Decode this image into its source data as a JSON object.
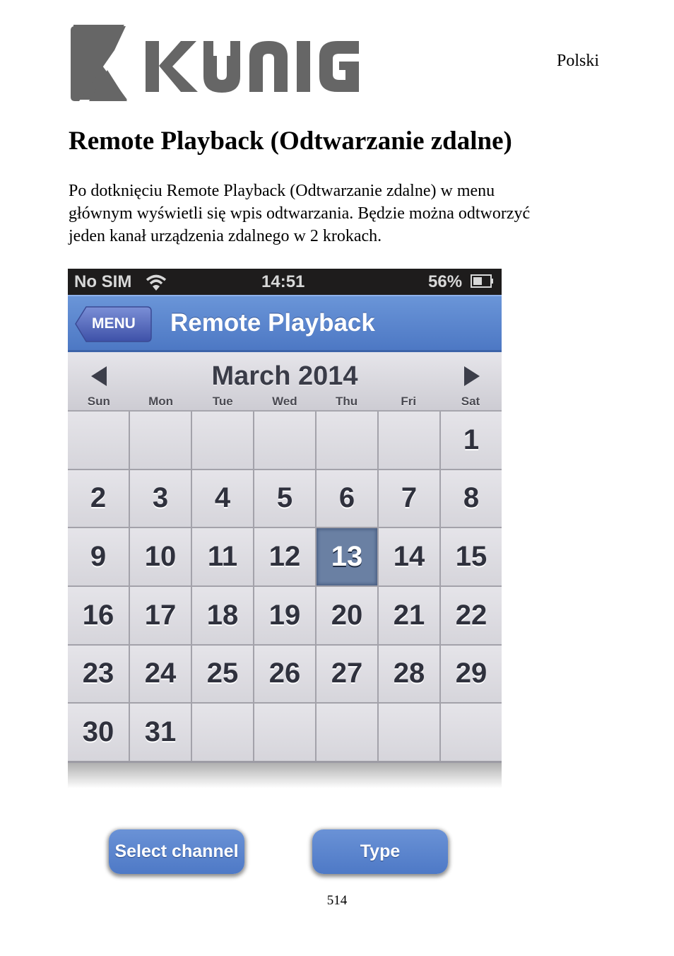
{
  "header": {
    "logo_text": "KÖNIG",
    "language": "Polski"
  },
  "document": {
    "title": "Remote Playback (Odtwarzanie zdalne)",
    "paragraph_lines": [
      "Po dotknięciu Remote Playback (Odtwarzanie zdalne) w menu",
      "głównym wyświetli się wpis odtwarzania. Będzie można odtworzyć",
      "jeden kanał urządzenia zdalnego w 2 krokach."
    ],
    "page_number": "514"
  },
  "phone": {
    "statusbar": {
      "carrier": "No SIM",
      "time": "14:51",
      "battery_percent": "56%",
      "battery_level": 0.56
    },
    "navbar": {
      "back_label": "MENU",
      "title": "Remote Playback"
    },
    "calendar": {
      "month_title": "March 2014",
      "weekdays": [
        "Sun",
        "Mon",
        "Tue",
        "Wed",
        "Thu",
        "Fri",
        "Sat"
      ],
      "selected_day": "13",
      "weeks": [
        [
          "",
          "",
          "",
          "",
          "",
          "",
          "1"
        ],
        [
          "2",
          "3",
          "4",
          "5",
          "6",
          "7",
          "8"
        ],
        [
          "9",
          "10",
          "11",
          "12",
          "13",
          "14",
          "15"
        ],
        [
          "16",
          "17",
          "18",
          "19",
          "20",
          "21",
          "22"
        ],
        [
          "23",
          "24",
          "25",
          "26",
          "27",
          "28",
          "29"
        ],
        [
          "30",
          "31",
          "",
          "",
          "",
          "",
          ""
        ]
      ]
    },
    "buttons": {
      "select_channel": "Select channel",
      "type": "Type"
    }
  },
  "colors": {
    "navbar_blue": "#5a86d0",
    "selected_day": "#6a80a3",
    "logo_gray": "#666666"
  }
}
